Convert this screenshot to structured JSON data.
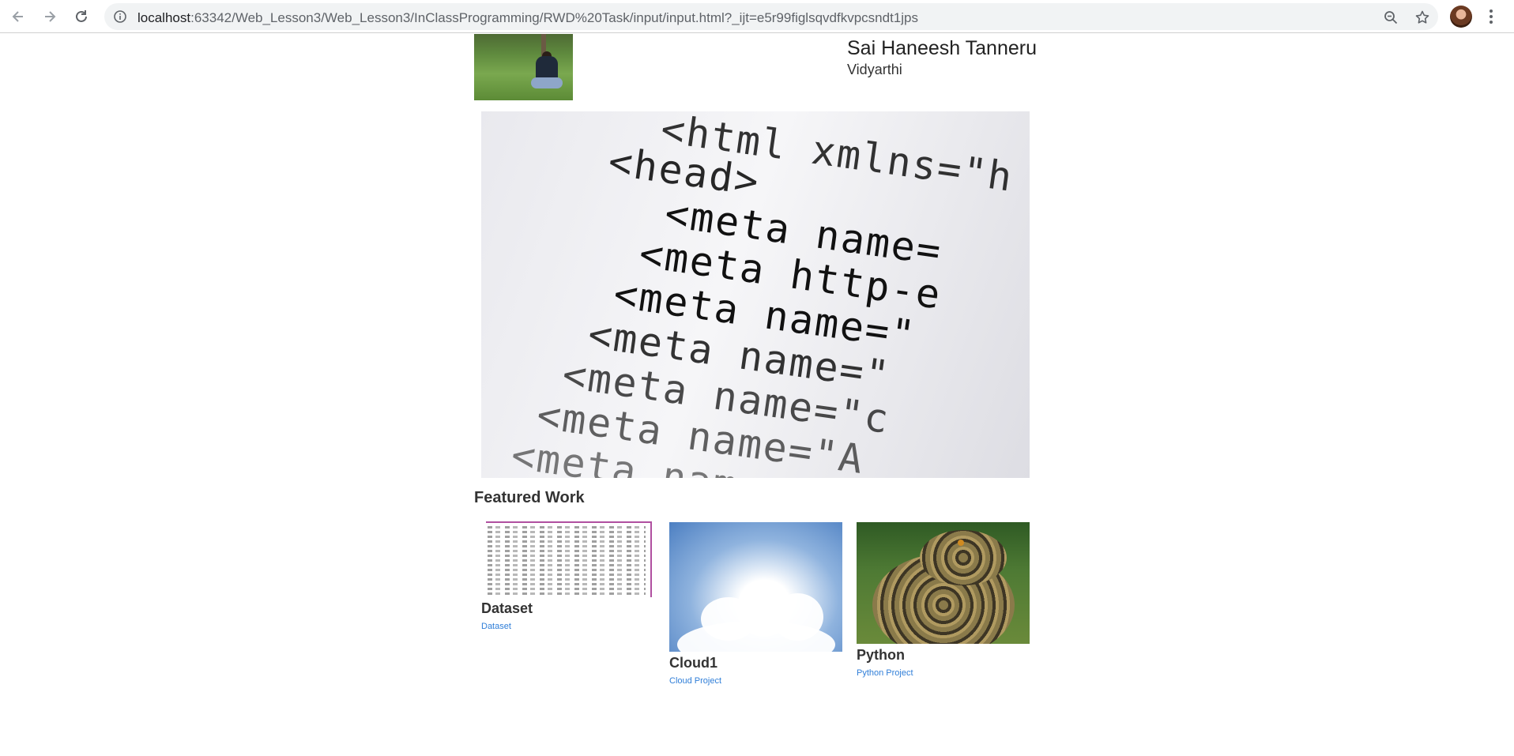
{
  "browser": {
    "url_host": "localhost",
    "url_path": ":63342/Web_Lesson3/Web_Lesson3/InClassProgramming/RWD%20Task/input/input.html?_ijt=e5r99figlsqvdfkvpcsndt1jps",
    "icons": {
      "back": "arrow-left-icon",
      "forward": "arrow-right-icon",
      "reload": "reload-icon",
      "info": "info-icon",
      "zoom": "zoom-icon",
      "bookmark": "star-icon",
      "profile": "avatar",
      "menu": "kebab-menu-icon"
    }
  },
  "profile": {
    "name": "Sai Haneesh Tanneru",
    "role": "Vidyarthi"
  },
  "hero": {
    "code_lines": [
      "<html xmlns=\"h",
      "<head>",
      "<meta name=",
      "<meta http-e",
      "<meta name=\"",
      "<meta name=\"",
      "<meta name=\"c",
      "<meta name=\"A",
      "<meta name=\"d"
    ]
  },
  "featured": {
    "title": "Featured Work",
    "items": [
      {
        "title": "Dataset",
        "link": "Dataset"
      },
      {
        "title": "Cloud1",
        "link": "Cloud Project"
      },
      {
        "title": "Python",
        "link": "Python Project"
      }
    ]
  },
  "colors": {
    "link": "#2f7ed8",
    "chrome_bg": "#f1f3f4",
    "text": "#333333"
  }
}
